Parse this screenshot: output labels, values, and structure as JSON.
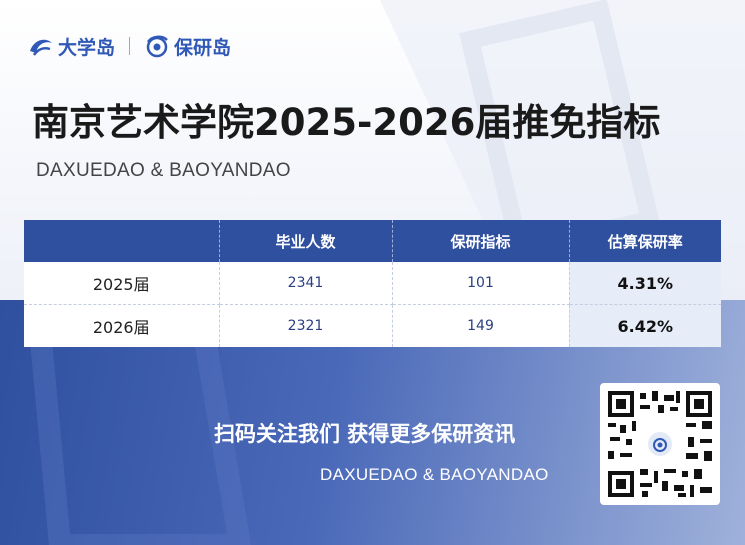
{
  "logos": {
    "left_name": "大学岛",
    "right_name": "保研岛"
  },
  "title": "南京艺术学院2025-2026届推免指标",
  "subtitle": "DAXUEDAO & BAOYANDAO",
  "table": {
    "headers": [
      "",
      "毕业人数",
      "保研指标",
      "估算保研率"
    ],
    "rows": [
      {
        "year": "2025届",
        "graduates": "2341",
        "quota": "101",
        "rate": "4.31%"
      },
      {
        "year": "2026届",
        "graduates": "2321",
        "quota": "149",
        "rate": "6.42%"
      }
    ]
  },
  "footer": {
    "cta": "扫码关注我们 获得更多保研资讯",
    "sub": "DAXUEDAO & BAOYANDAO"
  },
  "colors": {
    "brand_blue": "#2f58b7",
    "header_blue": "#2f4f9f",
    "rate_highlight": "#e6ecf8"
  }
}
